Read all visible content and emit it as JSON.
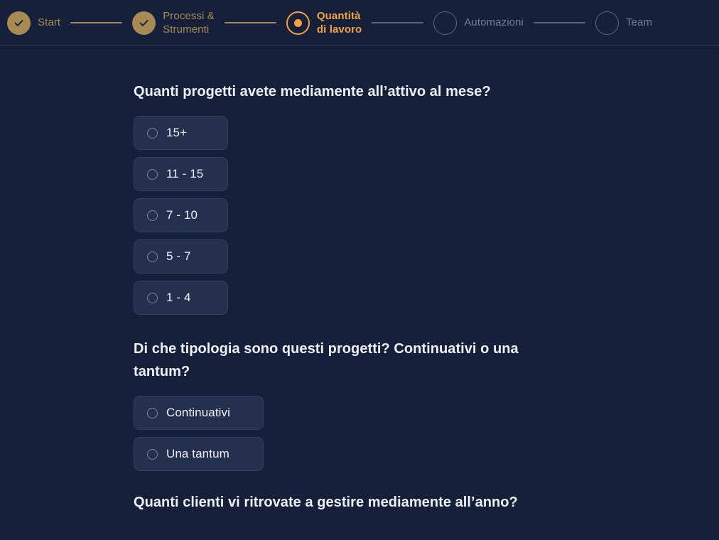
{
  "stepper": {
    "steps": [
      {
        "label": "Start",
        "state": "done",
        "icon": "check-icon"
      },
      {
        "label": "Processi &\nStrumenti",
        "state": "done",
        "icon": "check-icon"
      },
      {
        "label": "Quantità\ndi lavoro",
        "state": "active",
        "icon": "dot-icon"
      },
      {
        "label": "Automazioni",
        "state": "todo",
        "icon": "empty-circle-icon"
      },
      {
        "label": "Team",
        "state": "todo",
        "icon": "empty-circle-icon"
      }
    ],
    "connectors": [
      "gold",
      "gold",
      "grey",
      "grey"
    ]
  },
  "colors": {
    "background": "#16203a",
    "gold_muted": "#a78a52",
    "orange_active": "#f2a341",
    "grey_inactive": "#707d99",
    "card_bg": "#24304d",
    "card_border": "#33405f",
    "text_primary": "#eef1f7"
  },
  "questions": [
    {
      "text": "Quanti progetti avete mediamente all’attivo al mese?",
      "options": [
        {
          "label": "15+",
          "selected": false
        },
        {
          "label": "11 - 15",
          "selected": false
        },
        {
          "label": "7 - 10",
          "selected": false
        },
        {
          "label": "5 - 7",
          "selected": false
        },
        {
          "label": "1 - 4",
          "selected": false
        }
      ]
    },
    {
      "text": "Di che tipologia sono questi progetti? Continuativi o una tantum?",
      "options": [
        {
          "label": "Continuativi",
          "selected": false
        },
        {
          "label": "Una tantum",
          "selected": false
        }
      ]
    },
    {
      "text": "Quanti clienti vi ritrovate a gestire mediamente all’anno?",
      "options": []
    }
  ]
}
